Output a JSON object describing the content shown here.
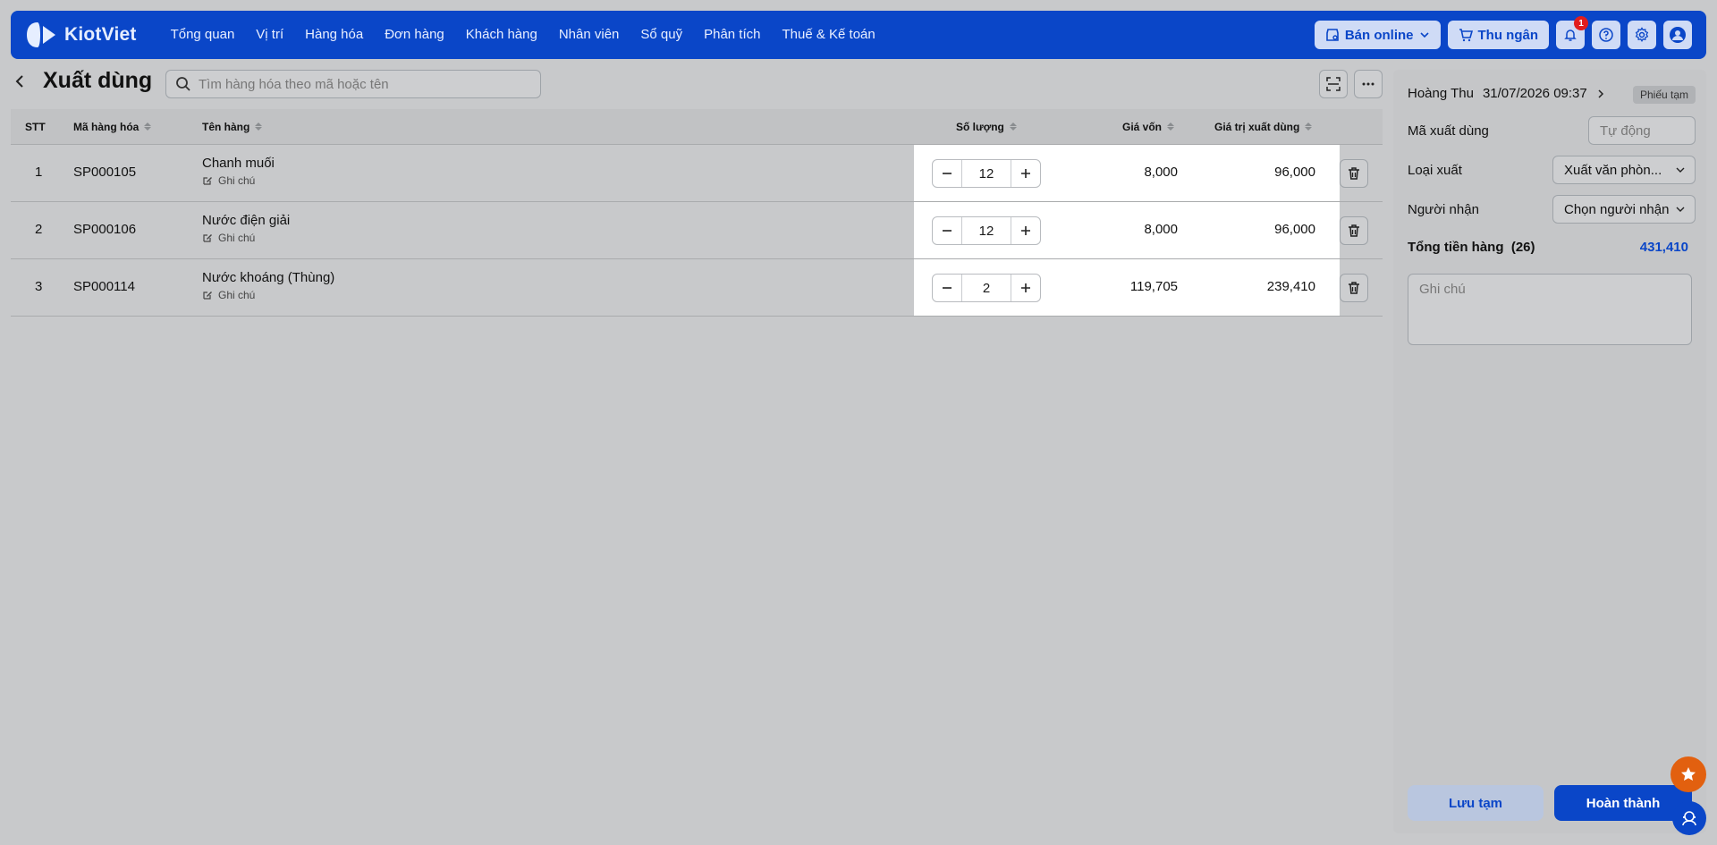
{
  "app": {
    "brand": "KiotViet"
  },
  "nav": {
    "items": [
      "Tổng quan",
      "Vị trí",
      "Hàng hóa",
      "Đơn hàng",
      "Khách hàng",
      "Nhân viên",
      "Sổ quỹ",
      "Phân tích",
      "Thuế & Kế toán"
    ],
    "sell_online": "Bán online",
    "cashier": "Thu ngân",
    "notif_count": "1"
  },
  "page": {
    "title": "Xuất dùng",
    "search_placeholder": "Tìm hàng hóa theo mã hoặc tên"
  },
  "table": {
    "headers": {
      "stt": "STT",
      "code": "Mã hàng hóa",
      "name": "Tên hàng",
      "qty": "Số lượng",
      "cost": "Giá vốn",
      "value": "Giá trị xuất dùng"
    },
    "note_label": "Ghi chú",
    "rows": [
      {
        "stt": "1",
        "code": "SP000105",
        "name": "Chanh muối",
        "qty": "12",
        "cost": "8,000",
        "value": "96,000"
      },
      {
        "stt": "2",
        "code": "SP000106",
        "name": "Nước điện giải",
        "qty": "12",
        "cost": "8,000",
        "value": "96,000"
      },
      {
        "stt": "3",
        "code": "SP000114",
        "name": "Nước khoáng (Thùng)",
        "qty": "2",
        "cost": "119,705",
        "value": "239,410"
      }
    ]
  },
  "panel": {
    "user": "Hoàng Thu",
    "datetime": "31/07/2026 09:37",
    "status": "Phiếu tạm",
    "code_label": "Mã xuất dùng",
    "code_placeholder": "Tự động",
    "type_label": "Loại xuất",
    "type_value": "Xuất văn phòn...",
    "receiver_label": "Người nhận",
    "receiver_value": "Chọn người nhận",
    "total_label": "Tổng tiền hàng",
    "total_count": "(26)",
    "total_value": "431,410",
    "note_placeholder": "Ghi chú",
    "save_label": "Lưu tạm",
    "done_label": "Hoàn thành"
  },
  "colors": {
    "brand": "#0a46c8",
    "fab": "#e2600f",
    "badge": "#e11d1d"
  }
}
